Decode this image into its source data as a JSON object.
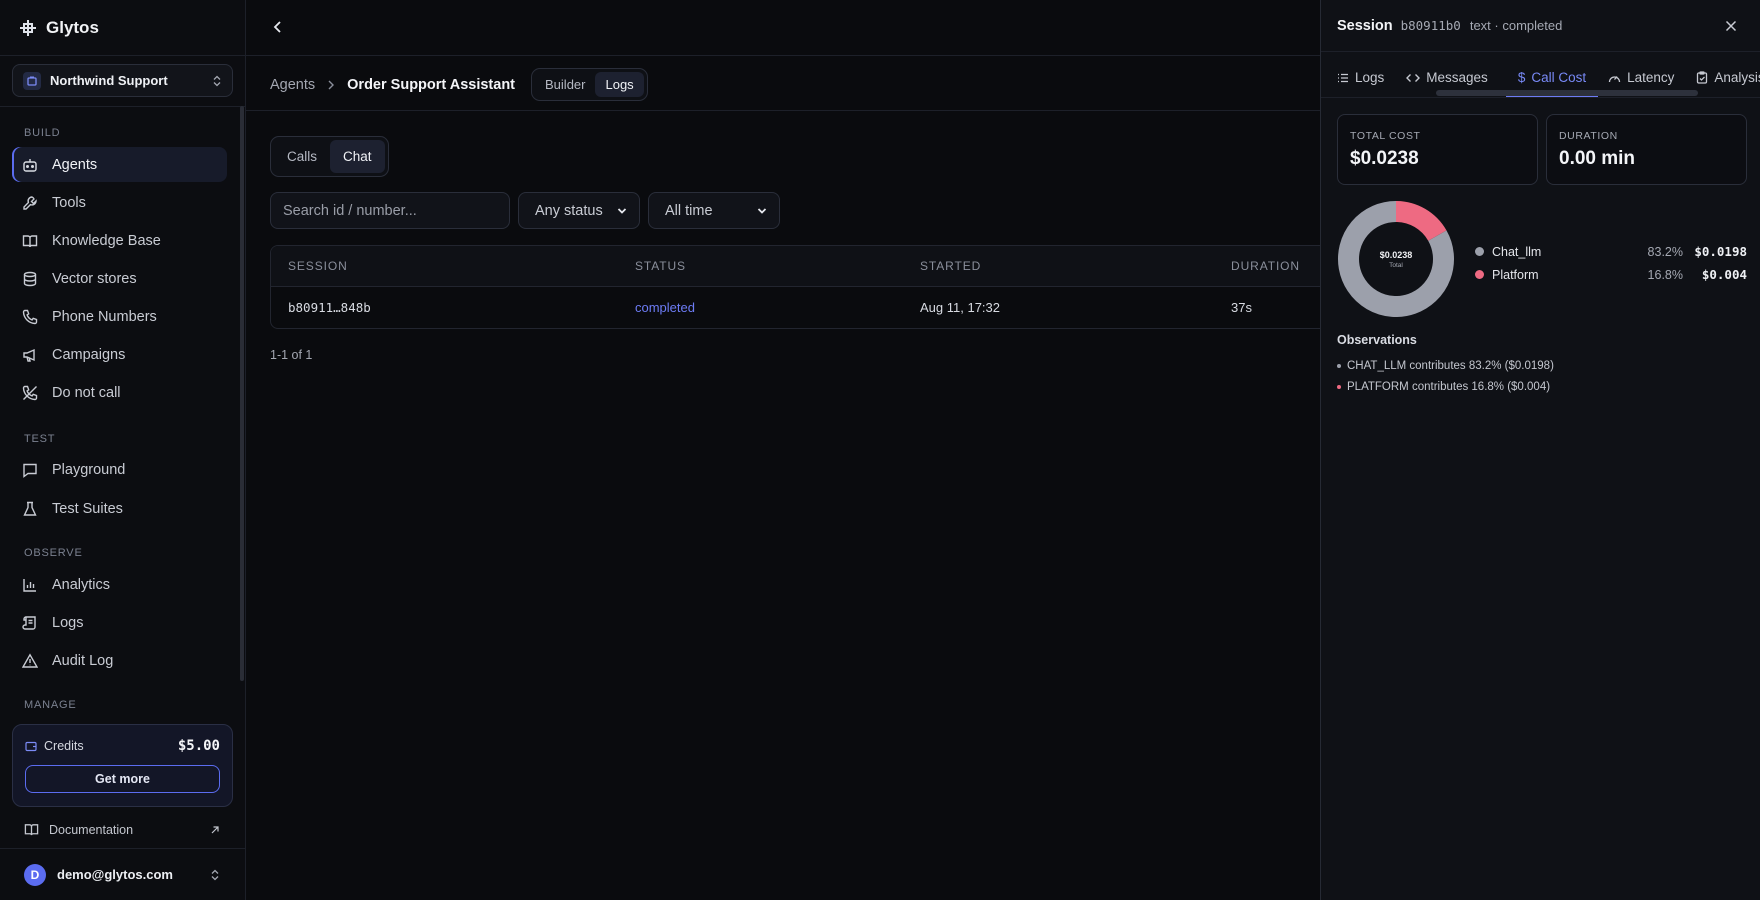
{
  "brand": {
    "name": "Glytos"
  },
  "org": {
    "name": "Northwind Support"
  },
  "sidebar": {
    "sections": [
      "BUILD",
      "TEST",
      "OBSERVE",
      "MANAGE"
    ],
    "items": [
      {
        "label": "Agents",
        "icon": "bot-icon"
      },
      {
        "label": "Tools",
        "icon": "wrench-icon"
      },
      {
        "label": "Knowledge Base",
        "icon": "book-icon"
      },
      {
        "label": "Vector stores",
        "icon": "database-icon"
      },
      {
        "label": "Phone Numbers",
        "icon": "phone-icon"
      },
      {
        "label": "Campaigns",
        "icon": "megaphone-icon"
      },
      {
        "label": "Do not call",
        "icon": "phone-off-icon"
      },
      {
        "label": "Playground",
        "icon": "chat-icon"
      },
      {
        "label": "Test Suites",
        "icon": "flask-icon"
      },
      {
        "label": "Analytics",
        "icon": "bar-chart-icon"
      },
      {
        "label": "Logs",
        "icon": "scroll-icon"
      },
      {
        "label": "Audit Log",
        "icon": "warning-icon"
      }
    ],
    "credits": {
      "label": "Credits",
      "amount": "$5.00",
      "button": "Get more"
    },
    "docs": "Documentation",
    "user": {
      "initial": "D",
      "email": "demo@glytos.com"
    }
  },
  "main": {
    "breadcrumb": {
      "parent": "Agents",
      "current": "Order Support Assistant"
    },
    "view_toggle": [
      "Builder",
      "Logs"
    ],
    "mode_tabs": [
      "Calls",
      "Chat"
    ],
    "search_placeholder": "Search id / number...",
    "status_filter": "Any status",
    "time_filter": "All time",
    "table": {
      "headers": [
        "SESSION",
        "STATUS",
        "STARTED",
        "DURATION"
      ],
      "rows": [
        {
          "session": "b80911…848b",
          "status": "completed",
          "started": "Aug 11, 17:32",
          "duration": "37s"
        }
      ]
    },
    "pager": "1-1 of 1"
  },
  "panel": {
    "title": "Session",
    "session_id": "b80911b0",
    "meta": "text · completed",
    "tabs": [
      "Logs",
      "Messages",
      "Call Cost",
      "Latency",
      "Analysis"
    ],
    "total_cost": {
      "label": "TOTAL COST",
      "value": "$0.0238"
    },
    "duration": {
      "label": "DURATION",
      "value": "0.00 min"
    },
    "donut_center": "$0.0238",
    "donut_sub": "Total",
    "observations_title": "Observations",
    "observations": [
      "CHAT_LLM contributes 83.2% ($0.0198)",
      "PLATFORM contributes 16.8% ($0.004)"
    ]
  },
  "chart_data": {
    "type": "pie",
    "categories": [
      "Chat_llm",
      "Platform"
    ],
    "values": [
      83.2,
      16.8
    ],
    "costs": [
      "$0.0198",
      "$0.004"
    ],
    "percent_labels": [
      "83.2%",
      "16.8%"
    ],
    "colors": [
      "#9ca0ab",
      "#ee6a82"
    ]
  },
  "colors": {
    "accent": "#6d7cf5",
    "platform": "#ee6a82",
    "chat_llm": "#9ca0ab"
  }
}
